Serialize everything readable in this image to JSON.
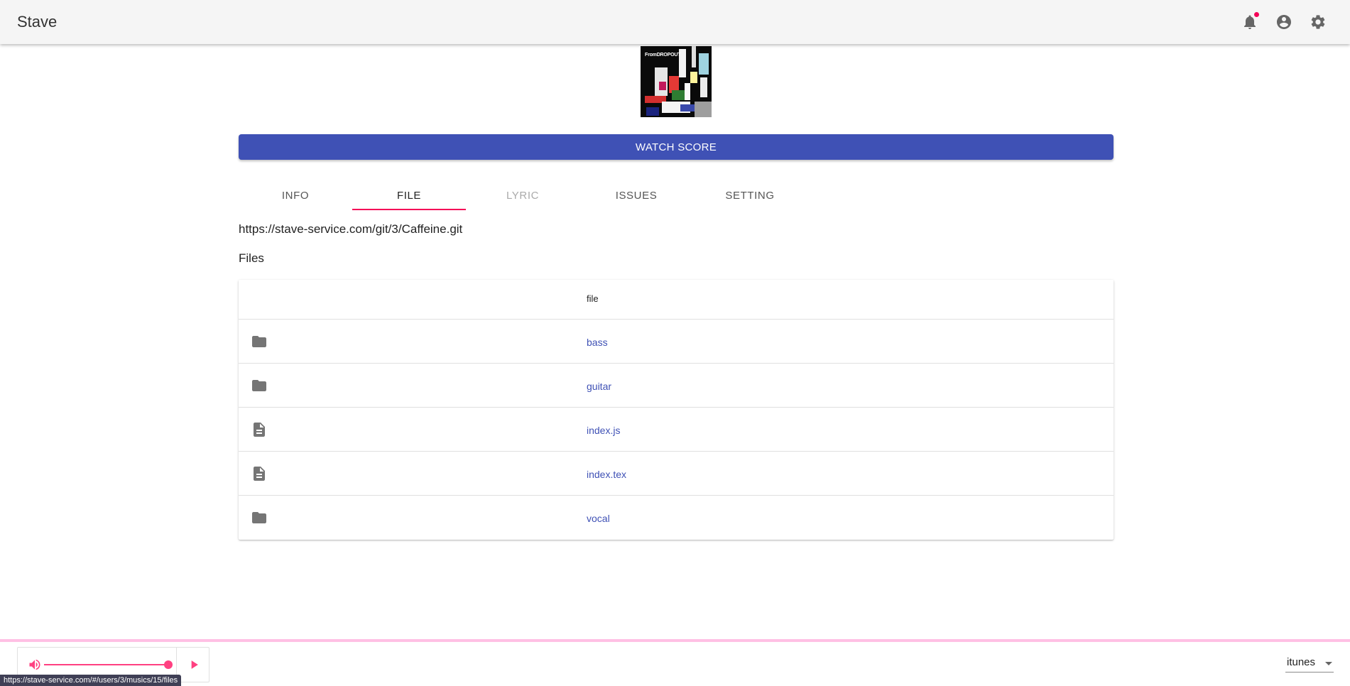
{
  "app": {
    "title": "Stave"
  },
  "header": {
    "icons": [
      "bell-icon",
      "account-circle-icon",
      "gear-icon"
    ],
    "notification_dot_color": "#f50057"
  },
  "album": {
    "cover_text": "FromDROPOUT"
  },
  "watch_score": {
    "label": "WATCH SCORE",
    "color": "#3f51b5"
  },
  "tabs": [
    {
      "label": "INFO",
      "state": "normal"
    },
    {
      "label": "FILE",
      "state": "active"
    },
    {
      "label": "LYRIC",
      "state": "disabled"
    },
    {
      "label": "ISSUES",
      "state": "normal"
    },
    {
      "label": "SETTING",
      "state": "normal"
    }
  ],
  "repo": {
    "url": "https://stave-service.com/git/3/Caffeine.git"
  },
  "files": {
    "heading": "Files",
    "column_header": "file",
    "rows": [
      {
        "name": "bass",
        "icon": "folder-icon"
      },
      {
        "name": "guitar",
        "icon": "folder-icon"
      },
      {
        "name": "index.js",
        "icon": "file-icon"
      },
      {
        "name": "index.tex",
        "icon": "file-icon"
      },
      {
        "name": "vocal",
        "icon": "folder-icon"
      }
    ]
  },
  "player": {
    "volume": 1.0,
    "accent_color": "#ff4081",
    "source": "itunes"
  },
  "statusbar": {
    "url": "https://stave-service.com/#/users/3/musics/15/files"
  }
}
